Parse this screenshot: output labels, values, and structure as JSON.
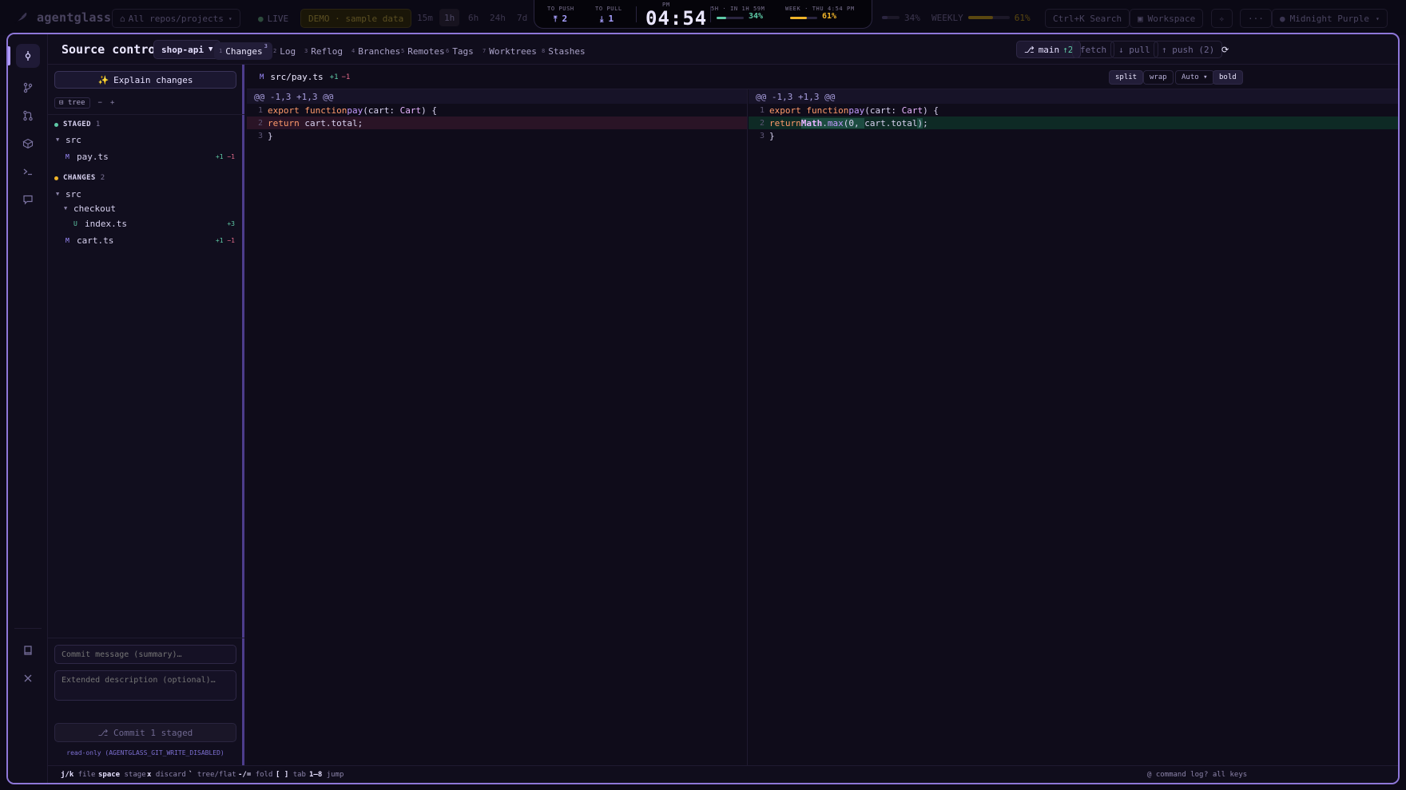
{
  "app": {
    "brand": "agentglass",
    "scope_label": "All repos/projects",
    "live_label": "LIVE",
    "demo_label": "DEMO · sample data",
    "time_ranges": [
      "15m",
      "1h",
      "6h",
      "24h",
      "7d"
    ],
    "selected_range": "1h",
    "right_usage_percent": "34%",
    "weekly_label": "WEEKLY",
    "weekly_percent": "61%",
    "weekly_fraction": 0.61,
    "search_label": "Ctrl+K Search",
    "workspace_label": "Workspace",
    "more_label": "···",
    "theme_label": "Midnight Purple"
  },
  "stats": {
    "to_push_label": "TO PUSH",
    "to_push_value": "2",
    "to_pull_label": "TO PULL",
    "to_pull_value": "1",
    "ampm": "PM",
    "clock": "04:54",
    "session_label": "5H · IN 1H 59M",
    "session_percent": "34%",
    "session_fraction": 0.34,
    "week_label": "WEEK · THU 4:54 PM",
    "week_percent": "61%",
    "week_fraction": 0.61
  },
  "header": {
    "title": "Source control",
    "repo": "shop-api",
    "tabs": [
      {
        "num": "1",
        "label": "Changes",
        "badge": "3"
      },
      {
        "num": "2",
        "label": "Log"
      },
      {
        "num": "3",
        "label": "Reflog"
      },
      {
        "num": "4",
        "label": "Branches"
      },
      {
        "num": "5",
        "label": "Remotes"
      },
      {
        "num": "6",
        "label": "Tags"
      },
      {
        "num": "7",
        "label": "Worktrees"
      },
      {
        "num": "8",
        "label": "Stashes"
      }
    ],
    "branch": "main",
    "branch_ahead": "↑2",
    "fetch": "fetch",
    "pull": "↓ pull",
    "push": "↑ push (2)",
    "refresh": "⟳"
  },
  "files": {
    "explain": "Explain changes",
    "tree_toggle": "tree",
    "collapse": "−",
    "expand": "+",
    "staged_label": "STAGED",
    "staged_count": "1",
    "staged_tree": {
      "folder": "src",
      "file": {
        "status": "M",
        "name": "pay.ts",
        "add": "+1",
        "del": "−1"
      }
    },
    "changes_label": "CHANGES",
    "changes_count": "2",
    "changes_tree": {
      "folder": "src",
      "subfolder": "checkout",
      "subfile": {
        "status": "U",
        "name": "index.ts",
        "add": "+3"
      },
      "file": {
        "status": "M",
        "name": "cart.ts",
        "add": "+1",
        "del": "−1"
      }
    },
    "commit_placeholder": "Commit message (summary)…",
    "description_placeholder": "Extended description (optional)…",
    "commit_button": "⎇ Commit 1 staged",
    "readonly_note": "read-only (AGENTGLASS_GIT_WRITE_DISABLED)"
  },
  "diff": {
    "status": "M",
    "path": "src/pay.ts",
    "add": "+1",
    "del": "−1",
    "buttons": {
      "split": "split",
      "wrap": "wrap",
      "auto": "Auto ▾",
      "bold": "bold"
    },
    "hunk": "@@ -1,3 +1,3 @@",
    "left": {
      "l1_num": "1",
      "l2_num": "2",
      "l3_num": "3",
      "l1": {
        "kw": "export function",
        "fn": "pay",
        "p1": "(cart: ",
        "ty": "Cart",
        "p2": ") {"
      },
      "l2": {
        "kw": "return",
        "rest": " cart.total;"
      },
      "l3": "}"
    },
    "right": {
      "l1_num": "1",
      "l2_num": "2",
      "l3_num": "3",
      "l1": {
        "kw": "export function",
        "fn": "pay",
        "p1": "(cart: ",
        "ty": "Cart",
        "p2": ") {"
      },
      "l2": {
        "kw": "return",
        "hl1": "Math",
        "dot": ".",
        "fn": "max",
        "hl2": "(0, ",
        "mid": "cart.total",
        "hl3": ")",
        "end": ";"
      },
      "l3": "}"
    }
  },
  "footer": {
    "keys": [
      {
        "k": "j/k",
        "d": "file"
      },
      {
        "k": "space",
        "d": "stage"
      },
      {
        "k": "x",
        "d": "discard"
      },
      {
        "k": "`",
        "d": "tree/flat"
      },
      {
        "k": "-/=",
        "d": "fold"
      },
      {
        "k": "[ ]",
        "d": "tab"
      },
      {
        "k": "1–8",
        "d": "jump"
      }
    ],
    "command_log": "@ command log",
    "all_keys": "? all keys"
  }
}
